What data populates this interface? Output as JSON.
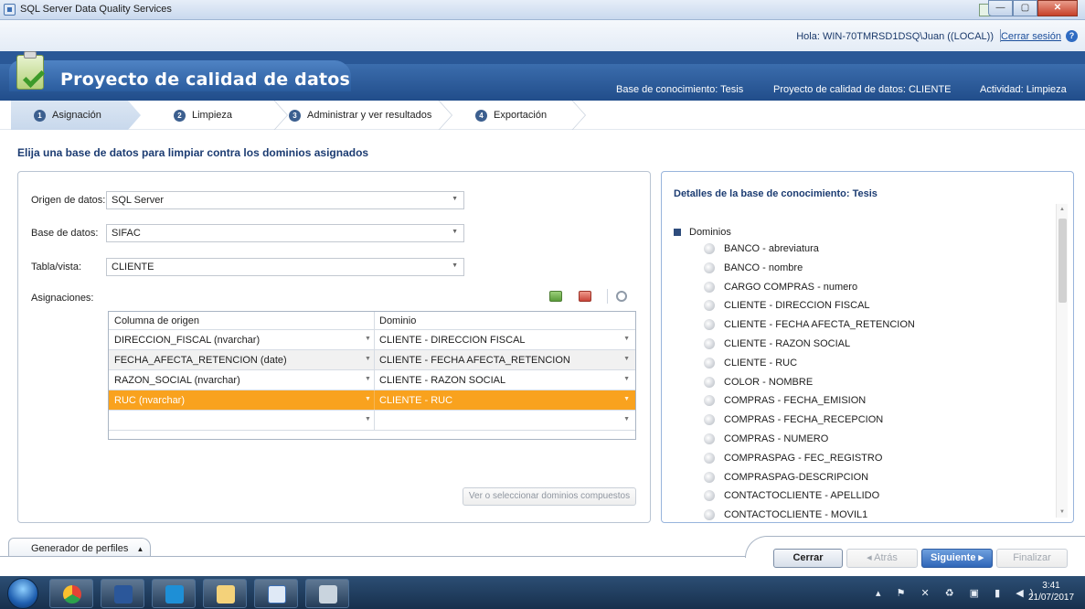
{
  "window": {
    "title": "SQL Server Data Quality Services",
    "controls": [
      "—",
      "▢",
      "✕"
    ]
  },
  "userbar": {
    "greeting": "Hola: WIN-70TMRSD1DSQ\\Juan ((LOCAL))",
    "logout": "Cerrar sesión",
    "help": "?"
  },
  "header": {
    "title": "Proyecto de calidad de datos",
    "knowledge_base": "Base de conocimiento: Tesis",
    "project": "Proyecto de calidad de datos: CLIENTE",
    "activity": "Actividad: Limpieza"
  },
  "steps": [
    {
      "num": "1",
      "label": "Asignación"
    },
    {
      "num": "2",
      "label": "Limpieza"
    },
    {
      "num": "3",
      "label": "Administrar y ver resultados"
    },
    {
      "num": "4",
      "label": "Exportación"
    }
  ],
  "instruction": "Elija una base de datos para limpiar contra los dominios asignados",
  "form": {
    "source_label": "Origen de datos:",
    "source_value": "SQL Server",
    "db_label": "Base de datos:",
    "db_value": "SIFAC",
    "table_label": "Tabla/vista:",
    "table_value": "CLIENTE",
    "mappings_label": "Asignaciones:"
  },
  "grid": {
    "headers": [
      "Columna de origen",
      "Dominio"
    ],
    "rows": [
      {
        "source": "DIRECCION_FISCAL (nvarchar)",
        "domain": "CLIENTE - DIRECCION FISCAL"
      },
      {
        "source": "FECHA_AFECTA_RETENCION (date)",
        "domain": "CLIENTE - FECHA AFECTA_RETENCION"
      },
      {
        "source": "RAZON_SOCIAL (nvarchar)",
        "domain": "CLIENTE - RAZON SOCIAL"
      },
      {
        "source": "RUC (nvarchar)",
        "domain": "CLIENTE - RUC"
      },
      {
        "source": "",
        "domain": ""
      }
    ],
    "selected_row": 3,
    "selected_color": "#f9a21e"
  },
  "composite_button": "Ver o seleccionar dominios compuestos",
  "details": {
    "title": "Detalles de la base de conocimiento: Tesis",
    "root": "Dominios",
    "items": [
      "BANCO - abreviatura",
      "BANCO - nombre",
      "CARGO COMPRAS - numero",
      "CLIENTE - DIRECCION FISCAL",
      "CLIENTE - FECHA AFECTA_RETENCION",
      "CLIENTE - RAZON SOCIAL",
      "CLIENTE - RUC",
      "COLOR - NOMBRE",
      "COMPRAS - FECHA_EMISION",
      "COMPRAS - FECHA_RECEPCION",
      "COMPRAS - NUMERO",
      "COMPRASPAG - FEC_REGISTRO",
      "COMPRASPAG-DESCRIPCION",
      "CONTACTOCLIENTE - APELLIDO",
      "CONTACTOCLIENTE - MOVIL1"
    ]
  },
  "bottom": {
    "profiler_tab": "Generador de perfiles",
    "profiler_arrow": "▲",
    "close": "Cerrar",
    "back": "◂  Atrás",
    "next": "Siguiente  ▸",
    "finish": "Finalizar"
  },
  "taskbar": {
    "tray": "▴ ⚑ ✕ ♻ ▣ ▮ ◀)",
    "time": "3:41",
    "date": "21/07/2017"
  },
  "colors": {
    "header_blue": "#2a5897",
    "accent_orange": "#f9a21e",
    "title_blue": "#1c3c72"
  }
}
